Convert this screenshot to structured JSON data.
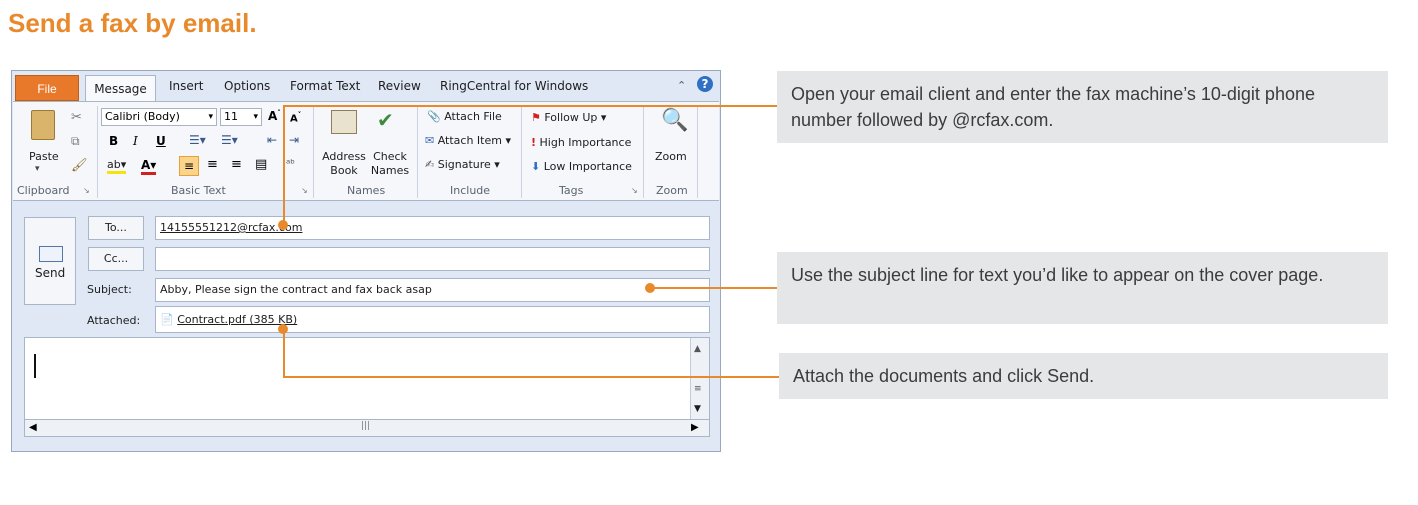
{
  "heading": "Send a fax by email.",
  "tabs": [
    "File",
    "Message",
    "Insert",
    "Options",
    "Format Text",
    "Review",
    "RingCentral for Windows"
  ],
  "ribbon": {
    "paste": "Paste",
    "font": "Calibri (Body)",
    "size": "11",
    "address_book": [
      "Address",
      "Book"
    ],
    "check_names": [
      "Check",
      "Names"
    ],
    "attach_file": "Attach File",
    "attach_item": "Attach Item",
    "signature": "Signature",
    "follow_up": "Follow Up",
    "high_importance": "High Importance",
    "low_importance": "Low Importance",
    "zoom": "Zoom",
    "groups": [
      "Clipboard",
      "Basic Text",
      "Names",
      "Include",
      "Tags",
      "Zoom"
    ]
  },
  "message": {
    "send": "Send",
    "to_button": "To...",
    "cc_button": "Cc...",
    "subject_label": "Subject:",
    "attached_label": "Attached:",
    "to_value": "14155551212@rcfax.com",
    "cc_value": "",
    "subject_value": "Abby, Please sign the contract and fax back asap",
    "attachment": "Contract.pdf (385 KB)"
  },
  "callouts": [
    "Open your email client and enter the fax machine’s 10-digit phone number followed by @rcfax.com.",
    "Use the subject line for text you’d like to appear on the cover page.",
    "Attach the documents and click Send."
  ],
  "colors": {
    "accent": "#e8892b",
    "callout_bg": "#e5e6e8"
  }
}
